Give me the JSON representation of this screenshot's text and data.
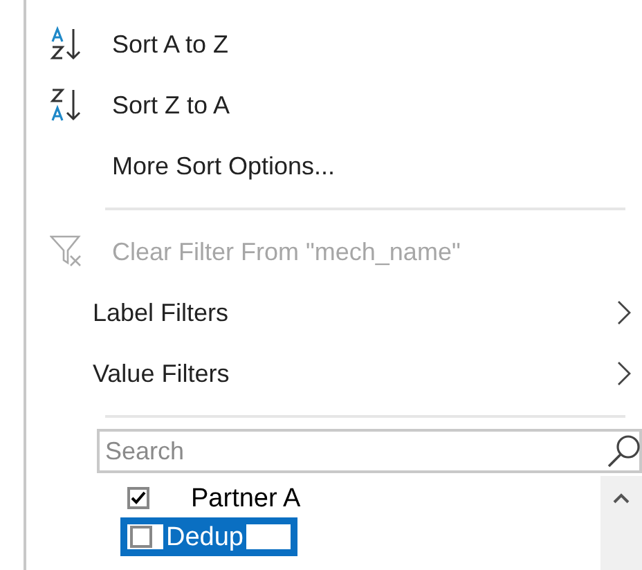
{
  "menu_items": [
    {
      "kind": "sort_asc",
      "label": "Sort A to Z",
      "disabled": false
    },
    {
      "kind": "sort_desc",
      "label": "Sort Z to A",
      "disabled": false
    },
    {
      "kind": "plain",
      "label": "More Sort Options...",
      "disabled": false
    },
    {
      "kind": "separator"
    },
    {
      "kind": "clear_filter",
      "label": "Clear Filter From \"mech_name\"",
      "disabled": true
    },
    {
      "kind": "submenu",
      "label": "Label Filters",
      "disabled": false
    },
    {
      "kind": "submenu",
      "label": "Value Filters",
      "disabled": false
    },
    {
      "kind": "separator"
    }
  ],
  "search": {
    "placeholder": "Search"
  },
  "list_items": [
    {
      "label": "Partner A",
      "checked": true,
      "focused": false
    },
    {
      "label": "Dedup",
      "checked": false,
      "focused": true
    }
  ]
}
